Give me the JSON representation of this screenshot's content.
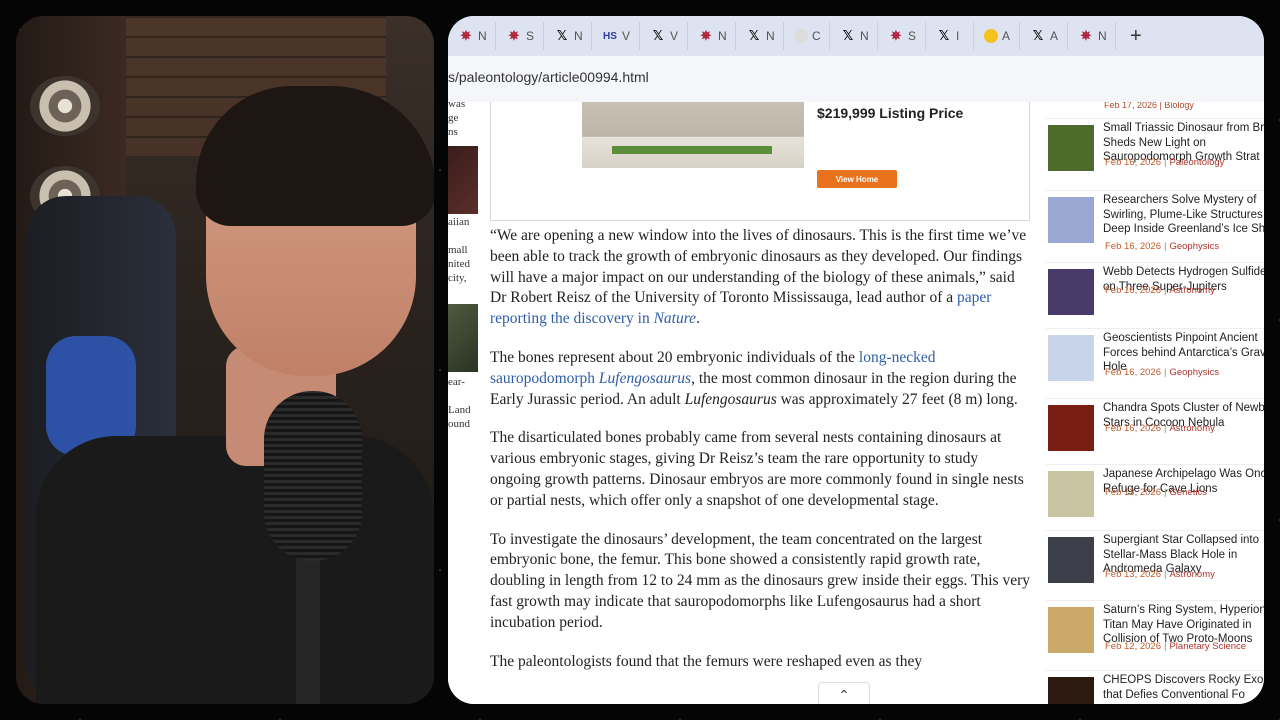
{
  "browser": {
    "tabs": [
      {
        "icon": "phys-icon",
        "text": "N"
      },
      {
        "icon": "phys-icon",
        "text": "S"
      },
      {
        "icon": "x-icon",
        "text": "N"
      },
      {
        "icon": "hs-icon",
        "text": "V"
      },
      {
        "icon": "x-icon",
        "text": "V"
      },
      {
        "icon": "phys-icon",
        "text": "N"
      },
      {
        "icon": "x-icon",
        "text": "N"
      },
      {
        "icon": "globe-icon",
        "text": "C"
      },
      {
        "icon": "x-icon",
        "text": "N"
      },
      {
        "icon": "phys-icon",
        "text": "S"
      },
      {
        "icon": "x-icon",
        "text": "I"
      },
      {
        "icon": "yellow-icon",
        "text": "A"
      },
      {
        "icon": "x-icon",
        "text": "A"
      },
      {
        "icon": "phys-icon",
        "text": "N"
      }
    ],
    "new_tab": "+",
    "url": "s/paleontology/article00994.html"
  },
  "left_sliver": {
    "texts": [
      "was",
      "ge",
      "ns",
      "aiian",
      "mall",
      "nited",
      "city,",
      "ear-",
      "Land",
      "ound"
    ]
  },
  "ad": {
    "price": "$219,999 Listing Price",
    "button": "View Home"
  },
  "article": {
    "p1": {
      "text": "“We are opening a new window into the lives of dinosaurs. This is the first time we’ve been able to track the growth of embryonic dinosaurs as they developed. Our findings will have a major impact on our understanding of the biology of these animals,” said Dr Robert Reisz of the University of Toronto Mississauga, lead author of a ",
      "link": "paper reporting the discovery in ",
      "link_italic": "Nature",
      "end": "."
    },
    "p2": {
      "pre": "The bones represent about 20 embryonic individuals of the ",
      "link": "long-necked sauropodomorph ",
      "link_italic": "Lufengosaurus",
      "mid": ", the most common dinosaur in the region during the Early Jurassic period. An adult ",
      "italic": "Lufengosaurus",
      "end": " was approximately 27 feet (8 m) long."
    },
    "p3": "The disarticulated bones probably came from several nests containing dinosaurs at various embryonic stages, giving Dr Reisz’s team the rare opportunity to study ongoing growth patterns. Dinosaur embryos are more commonly found in single nests or partial nests, which offer only a snapshot of one developmental stage.",
    "p4": "To investigate the dinosaurs’ development, the team concentrated on the largest embryonic bone, the femur. This bone showed a consistently rapid growth rate, doubling in length from 12 to 24 mm as the dinosaurs grew inside their eggs. This very fast growth may indicate that sauropodomorphs like Lufengosaurus had a short incubation period.",
    "p5_partial": "The paleontologists found that the femurs were reshaped even as they"
  },
  "sidebar": {
    "top_meta": "Feb 17, 2026 | Biology",
    "items": [
      {
        "title": "Small Triassic Dinosaur from Br Sheds New Light on Sauropodomorph Growth Strat",
        "date": "Feb 16, 2026",
        "category": "Paleontology",
        "thumb_color": "#4f6b2c"
      },
      {
        "title": "Researchers Solve Mystery of Swirling, Plume-Like Structures Deep Inside Greenland’s Ice She",
        "date": "Feb 16, 2026",
        "category": "Geophysics",
        "thumb_color": "#9aa7d0"
      },
      {
        "title": "Webb Detects Hydrogen Sulfide on Three Super-Jupiters",
        "date": "Feb 16, 2026",
        "category": "Astronomy",
        "thumb_color": "#4a3a6a"
      },
      {
        "title": "Geoscientists Pinpoint Ancient Forces behind Antarctica’s Grav Hole",
        "date": "Feb 16, 2026",
        "category": "Geophysics",
        "thumb_color": "#c8d4ea"
      },
      {
        "title": "Chandra Spots Cluster of Newb Stars in Cocoon Nebula",
        "date": "Feb 16, 2026",
        "category": "Astronomy",
        "thumb_color": "#7a1d12"
      },
      {
        "title": "Japanese Archipelago Was Once Refuge for Cave Lions",
        "date": "Feb 13, 2026",
        "category": "Genetics",
        "thumb_color": "#c9c4a2"
      },
      {
        "title": "Supergiant Star Collapsed into Stellar-Mass Black Hole in Andromeda Galaxy",
        "date": "Feb 13, 2026",
        "category": "Astronomy",
        "thumb_color": "#3c3f4a"
      },
      {
        "title": "Saturn’s Ring System, Hyperion Titan May Have Originated in Collision of Two Proto-Moons",
        "date": "Feb 12, 2026",
        "category": "Planetary Science",
        "thumb_color": "#c9a86a"
      },
      {
        "title": "CHEOPS Discovers Rocky Exop that Defies Conventional Fo",
        "date": "",
        "category": "",
        "thumb_color": "#2c1a10"
      }
    ]
  }
}
